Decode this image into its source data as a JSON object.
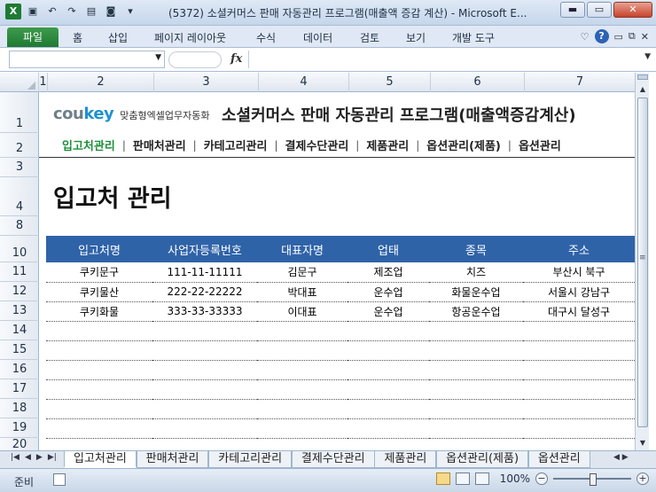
{
  "window": {
    "title": "(5372) 소셜커머스 판매 자동관리 프로그램(매출액 증감 계산) - Microsoft E...",
    "qat_icons": [
      "excel-logo-icon",
      "save-icon",
      "undo-icon",
      "redo-icon",
      "form-icon",
      "camera-icon",
      "customize-icon"
    ],
    "buttons": {
      "minimize": "▬",
      "maximize": "▭",
      "close": "✕"
    }
  },
  "ribbon": {
    "file_tab": "파일",
    "tabs": [
      "홈",
      "삽입",
      "페이지 레이아웃",
      "수식",
      "데이터",
      "검토",
      "보기",
      "개발 도구"
    ],
    "right": {
      "chevron": "♡",
      "help": "?",
      "min": "▭",
      "restore": "⧉",
      "close": "✕"
    }
  },
  "formula_bar": {
    "name_box": "",
    "fx": "fx",
    "formula": ""
  },
  "columns": [
    "1",
    "2",
    "3",
    "4",
    "5",
    "6",
    "7"
  ],
  "rows": [
    "1",
    "2",
    "3",
    "4",
    "8",
    "10",
    "11",
    "12",
    "13",
    "14",
    "15",
    "16",
    "17",
    "18",
    "19",
    "20"
  ],
  "brand": {
    "cou": "cou",
    "key": "key",
    "tagline": "맞춤형엑셀업무자동화"
  },
  "program_title": "소셜커머스 판매 자동관리 프로그램(매출액증감계산)",
  "nav": {
    "items": [
      "입고처관리",
      "판매처관리",
      "카테고리관리",
      "결제수단관리",
      "제품관리",
      "옵션관리(제품)",
      "옵션관리"
    ],
    "separator": "|"
  },
  "page_heading": "입고처 관리",
  "table": {
    "headers": [
      "입고처명",
      "사업자등록번호",
      "대표자명",
      "업태",
      "종목",
      "주소"
    ],
    "rows": [
      [
        "쿠키문구",
        "111-11-11111",
        "김문구",
        "제조업",
        "치즈",
        "부산시 북구"
      ],
      [
        "쿠키물산",
        "222-22-22222",
        "박대표",
        "운수업",
        "화물운수업",
        "서울시 강남구"
      ],
      [
        "쿠키화물",
        "333-33-33333",
        "이대표",
        "운수업",
        "항공운수업",
        "대구시 달성구"
      ],
      [
        "",
        "",
        "",
        "",
        "",
        ""
      ],
      [
        "",
        "",
        "",
        "",
        "",
        ""
      ],
      [
        "",
        "",
        "",
        "",
        "",
        ""
      ],
      [
        "",
        "",
        "",
        "",
        "",
        ""
      ],
      [
        "",
        "",
        "",
        "",
        "",
        ""
      ],
      [
        "",
        "",
        "",
        "",
        "",
        ""
      ]
    ]
  },
  "sheet_tabs": [
    "입고처관리",
    "판매처관리",
    "카테고리관리",
    "결제수단관리",
    "제품관리",
    "옵션관리(제품)",
    "옵션관리"
  ],
  "status": {
    "ready": "준비",
    "zoom": "100%",
    "zoom_minus": "−",
    "zoom_plus": "+"
  }
}
